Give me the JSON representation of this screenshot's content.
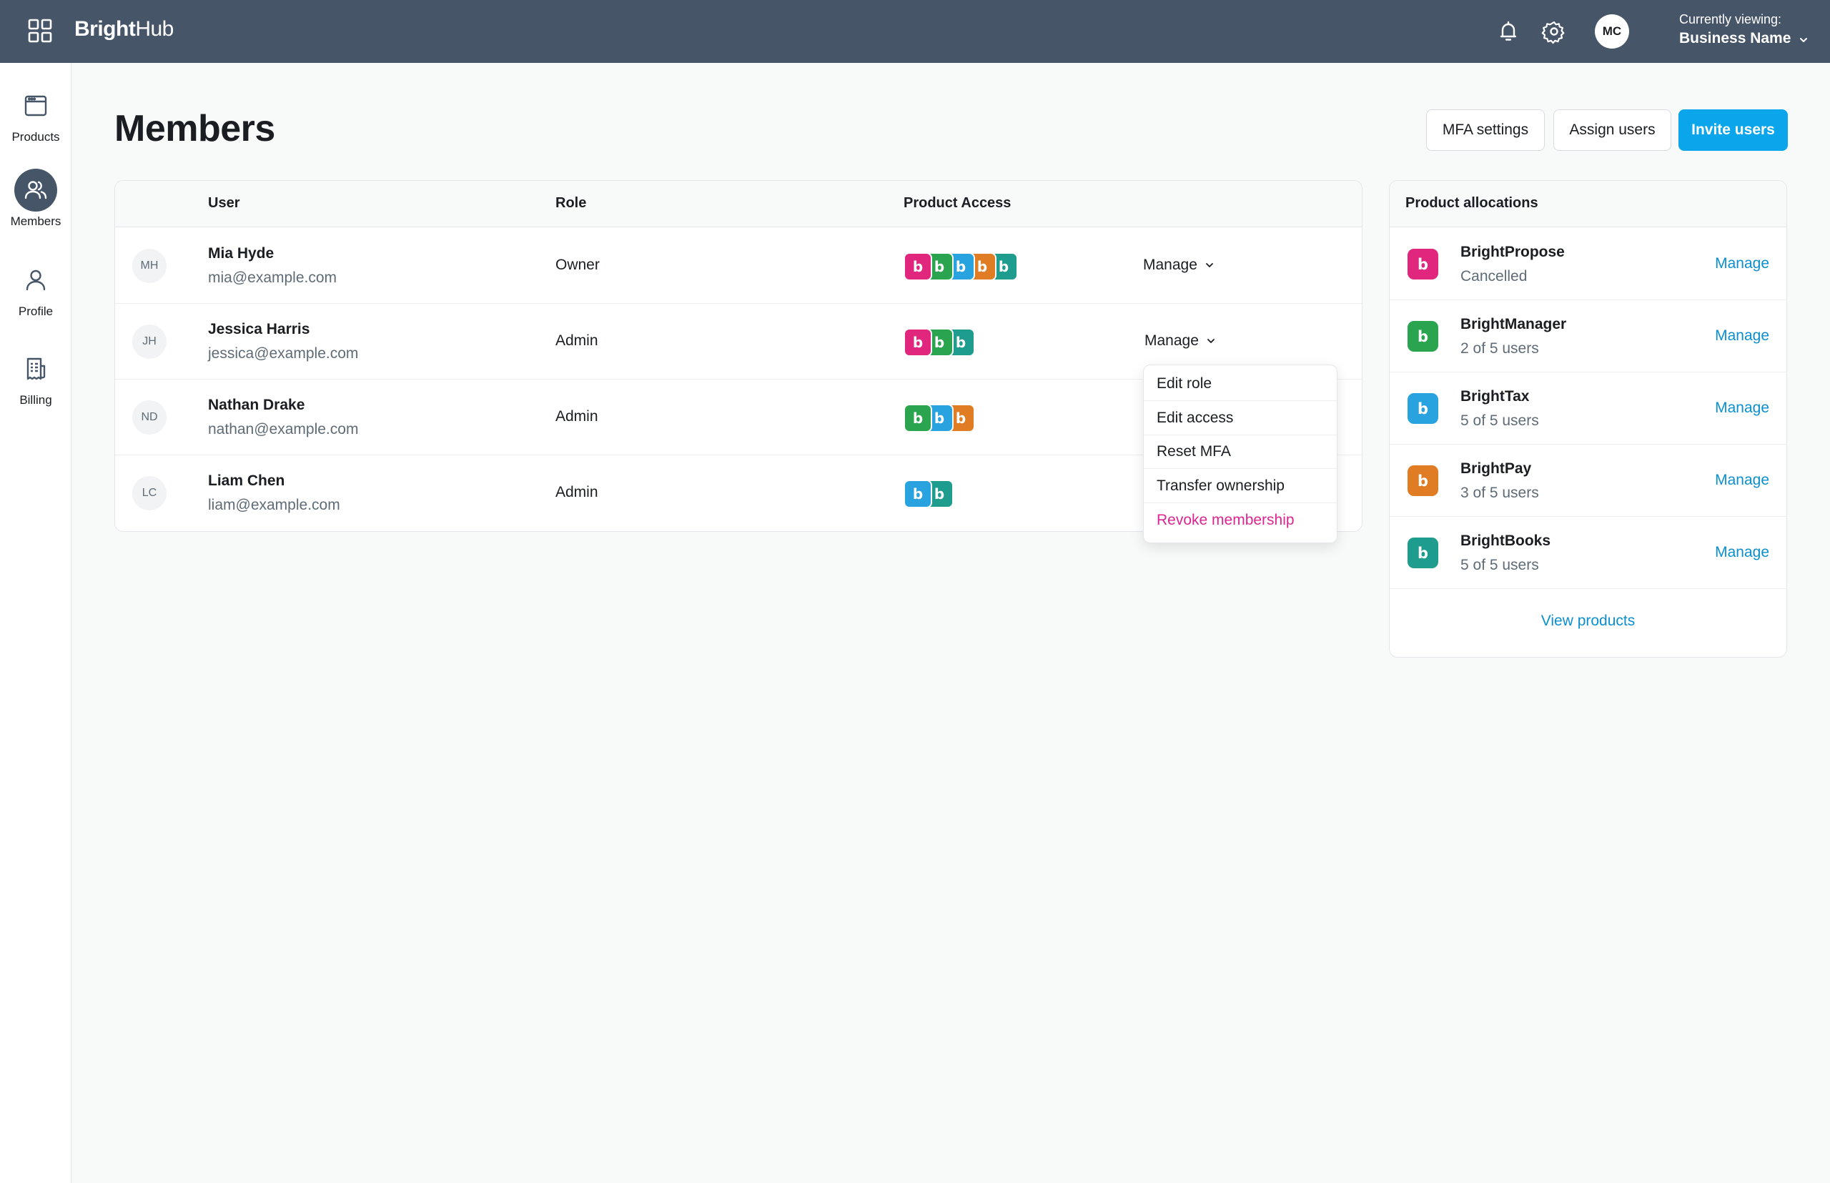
{
  "app": {
    "brand_bold": "Bright",
    "brand_light": "Hub",
    "user_initials": "MC",
    "viewing_caption": "Currently viewing:",
    "viewing_name": "Business Name"
  },
  "colors": {
    "topbar": "#475569",
    "accent": "#0ba5ec",
    "link": "#0b8fcf",
    "danger": "#dd2590",
    "pink": "#e0267d",
    "green": "#2aa44f",
    "blue": "#29a3e0",
    "orange": "#e07c23",
    "teal": "#1e9c8e"
  },
  "sidebar": {
    "items": [
      {
        "label": "Products",
        "icon": "window-icon",
        "active": false
      },
      {
        "label": "Members",
        "icon": "users-icon",
        "active": true
      },
      {
        "label": "Profile",
        "icon": "user-icon",
        "active": false
      },
      {
        "label": "Billing",
        "icon": "receipt-icon",
        "active": false
      }
    ]
  },
  "page": {
    "title": "Members",
    "buttons": {
      "mfa": "MFA settings",
      "assign": "Assign users",
      "invite": "Invite users"
    }
  },
  "members": {
    "columns": {
      "user": "User",
      "role": "Role",
      "access": "Product Access"
    },
    "manage_label": "Manage",
    "rows": [
      {
        "initials": "MH",
        "name": "Mia Hyde",
        "email": "mia@example.com",
        "role": "Owner",
        "access": [
          "pink",
          "green",
          "blue",
          "orange",
          "teal"
        ],
        "has_manage": true
      },
      {
        "initials": "JH",
        "name": "Jessica Harris",
        "email": "jessica@example.com",
        "role": "Admin",
        "access": [
          "pink",
          "green",
          "teal"
        ],
        "has_manage": true
      },
      {
        "initials": "ND",
        "name": "Nathan Drake",
        "email": "nathan@example.com",
        "role": "Admin",
        "access": [
          "green",
          "blue",
          "orange"
        ],
        "has_manage": false
      },
      {
        "initials": "LC",
        "name": "Liam Chen",
        "email": "liam@example.com",
        "role": "Admin",
        "access": [
          "blue",
          "teal"
        ],
        "has_manage": false
      }
    ]
  },
  "menu": {
    "items": [
      "Edit role",
      "Edit access",
      "Reset MFA",
      "Transfer ownership",
      "Revoke membership"
    ]
  },
  "allocations": {
    "title": "Product allocations",
    "manage_label": "Manage",
    "view_products": "View products",
    "items": [
      {
        "name": "BrightPropose",
        "status": "Cancelled",
        "color": "pink"
      },
      {
        "name": "BrightManager",
        "status": "2 of 5 users",
        "color": "green"
      },
      {
        "name": "BrightTax",
        "status": "5 of 5 users",
        "color": "blue"
      },
      {
        "name": "BrightPay",
        "status": "3 of 5 users",
        "color": "orange"
      },
      {
        "name": "BrightBooks",
        "status": "5 of 5 users",
        "color": "teal"
      }
    ]
  }
}
